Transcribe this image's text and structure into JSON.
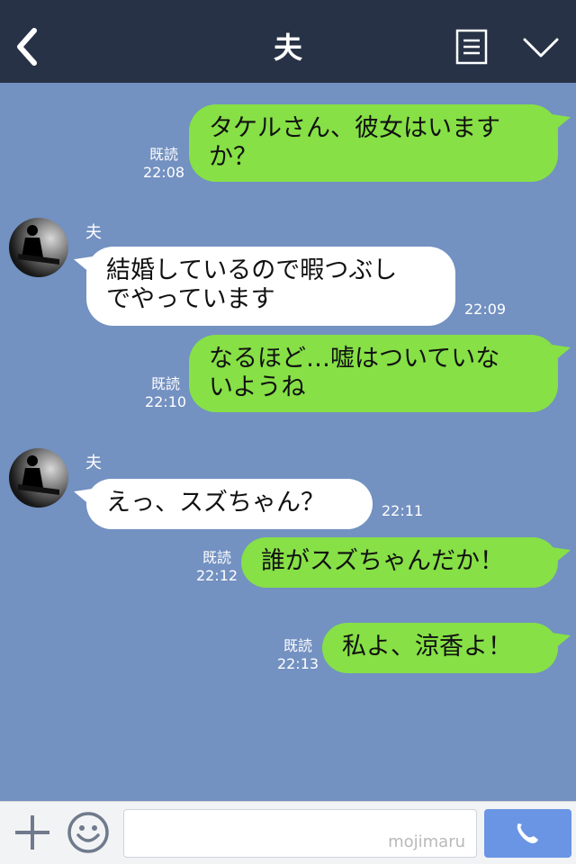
{
  "header": {
    "title": "夫"
  },
  "messages": [
    {
      "side": "out",
      "lines": [
        "タケルさん、彼女はいます",
        "か？"
      ],
      "read": "既読",
      "time": "22:08"
    },
    {
      "side": "in",
      "sender": "夫",
      "lines": [
        "結婚しているので暇つぶし",
        "でやっています"
      ],
      "time": "22:09"
    },
    {
      "side": "out",
      "lines": [
        "なるほど…嘘はついていな",
        "いようね"
      ],
      "read": "既読",
      "time": "22:10"
    },
    {
      "side": "in",
      "sender": "夫",
      "lines": [
        "えっ、スズちゃん？"
      ],
      "time": "22:11"
    },
    {
      "side": "out",
      "lines": [
        "誰がスズちゃんだか！"
      ],
      "read": "既読",
      "time": "22:12"
    },
    {
      "side": "out",
      "lines": [
        "私よ、涼香よ！"
      ],
      "read": "既読",
      "time": "22:13"
    }
  ],
  "footer": {
    "watermark": "mojimaru"
  },
  "icons": {
    "back": "chevron-left-icon",
    "menu": "list-icon",
    "dropdown": "chevron-down-icon",
    "add": "plus-icon",
    "emoji": "smiley-icon",
    "call": "phone-icon"
  },
  "colors": {
    "header_bg": "#273246",
    "chat_bg": "#7391c1",
    "out_bubble": "#86e046",
    "in_bubble": "#ffffff",
    "call_button": "#6a95e5"
  }
}
